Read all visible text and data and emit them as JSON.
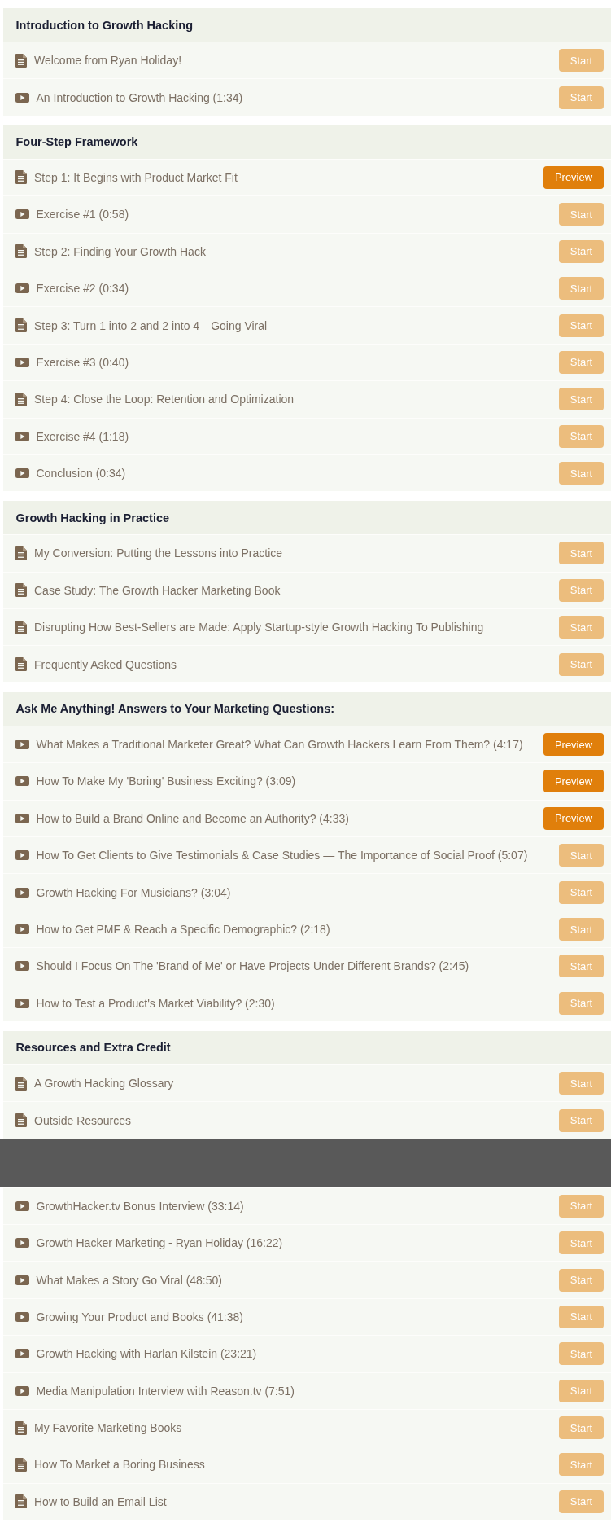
{
  "sections": [
    {
      "title": "Introduction to Growth Hacking",
      "items": [
        {
          "kind": "doc",
          "title": "Welcome from Ryan Holiday!",
          "action": {
            "kind": "start",
            "label": "Start"
          }
        },
        {
          "kind": "video",
          "title": "An Introduction to Growth Hacking (1:34)",
          "action": {
            "kind": "start",
            "label": "Start"
          }
        }
      ]
    },
    {
      "title": "Four-Step Framework",
      "items": [
        {
          "kind": "doc",
          "title": "Step 1: It Begins with Product Market Fit",
          "action": {
            "kind": "preview",
            "label": "Preview"
          }
        },
        {
          "kind": "video",
          "title": "Exercise #1 (0:58)",
          "action": {
            "kind": "start",
            "label": "Start"
          }
        },
        {
          "kind": "doc",
          "title": "Step 2: Finding Your Growth Hack",
          "action": {
            "kind": "start",
            "label": "Start"
          }
        },
        {
          "kind": "video",
          "title": "Exercise #2 (0:34)",
          "action": {
            "kind": "start",
            "label": "Start"
          }
        },
        {
          "kind": "doc",
          "title": "Step 3: Turn 1 into 2 and 2 into 4—Going Viral",
          "action": {
            "kind": "start",
            "label": "Start"
          }
        },
        {
          "kind": "video",
          "title": "Exercise #3 (0:40)",
          "action": {
            "kind": "start",
            "label": "Start"
          }
        },
        {
          "kind": "doc",
          "title": "Step 4: Close the Loop: Retention and Optimization",
          "action": {
            "kind": "start",
            "label": "Start"
          }
        },
        {
          "kind": "video",
          "title": "Exercise #4 (1:18)",
          "action": {
            "kind": "start",
            "label": "Start"
          }
        },
        {
          "kind": "video",
          "title": "Conclusion (0:34)",
          "action": {
            "kind": "start",
            "label": "Start"
          }
        }
      ]
    },
    {
      "title": "Growth Hacking in Practice",
      "items": [
        {
          "kind": "doc",
          "title": "My Conversion: Putting the Lessons into Practice",
          "action": {
            "kind": "start",
            "label": "Start"
          }
        },
        {
          "kind": "doc",
          "title": "Case Study: The Growth Hacker Marketing Book",
          "action": {
            "kind": "start",
            "label": "Start"
          }
        },
        {
          "kind": "doc",
          "title": "Disrupting How Best-Sellers are Made: Apply Startup-style Growth Hacking To Publishing",
          "action": {
            "kind": "start",
            "label": "Start"
          }
        },
        {
          "kind": "doc",
          "title": "Frequently Asked Questions",
          "action": {
            "kind": "start",
            "label": "Start"
          }
        }
      ]
    },
    {
      "title": "Ask Me Anything! Answers to Your Marketing Questions:",
      "items": [
        {
          "kind": "video",
          "title": "What Makes a Traditional Marketer Great? What Can Growth Hackers Learn From Them? (4:17)",
          "action": {
            "kind": "preview",
            "label": "Preview"
          }
        },
        {
          "kind": "video",
          "title": "How To Make My 'Boring' Business Exciting? (3:09)",
          "action": {
            "kind": "preview",
            "label": "Preview"
          }
        },
        {
          "kind": "video",
          "title": "How to Build a Brand Online and Become an Authority? (4:33)",
          "action": {
            "kind": "preview",
            "label": "Preview"
          }
        },
        {
          "kind": "video",
          "title": "How To Get Clients to Give Testimonials & Case Studies — The Importance of Social Proof (5:07)",
          "action": {
            "kind": "start",
            "label": "Start"
          }
        },
        {
          "kind": "video",
          "title": "Growth Hacking For Musicians? (3:04)",
          "action": {
            "kind": "start",
            "label": "Start"
          }
        },
        {
          "kind": "video",
          "title": "How to Get PMF & Reach a Specific Demographic? (2:18)",
          "action": {
            "kind": "start",
            "label": "Start"
          }
        },
        {
          "kind": "video",
          "title": "Should I Focus On The 'Brand of Me' or Have Projects Under Different Brands? (2:45)",
          "action": {
            "kind": "start",
            "label": "Start"
          }
        },
        {
          "kind": "video",
          "title": "How to Test a Product's Market Viability? (2:30)",
          "action": {
            "kind": "start",
            "label": "Start"
          }
        }
      ]
    },
    {
      "title": "Resources and Extra Credit",
      "items": [
        {
          "kind": "doc",
          "title": "A Growth Hacking Glossary",
          "action": {
            "kind": "start",
            "label": "Start"
          }
        },
        {
          "kind": "doc",
          "title": "Outside Resources",
          "action": {
            "kind": "start",
            "label": "Start"
          }
        },
        {
          "kind": "covered"
        },
        {
          "kind": "video",
          "title": "GrowthHacker.tv Bonus Interview (33:14)",
          "action": {
            "kind": "start",
            "label": "Start"
          }
        },
        {
          "kind": "video",
          "title": "Growth Hacker Marketing - Ryan Holiday (16:22)",
          "action": {
            "kind": "start",
            "label": "Start"
          }
        },
        {
          "kind": "video",
          "title": "What Makes a Story Go Viral (48:50)",
          "action": {
            "kind": "start",
            "label": "Start"
          }
        },
        {
          "kind": "video",
          "title": "Growing Your Product and Books (41:38)",
          "action": {
            "kind": "start",
            "label": "Start"
          }
        },
        {
          "kind": "video",
          "title": "Growth Hacking with Harlan Kilstein (23:21)",
          "action": {
            "kind": "start",
            "label": "Start"
          }
        },
        {
          "kind": "video",
          "title": "Media Manipulation Interview with Reason.tv (7:51)",
          "action": {
            "kind": "start",
            "label": "Start"
          }
        },
        {
          "kind": "doc",
          "title": "My Favorite Marketing Books",
          "action": {
            "kind": "start",
            "label": "Start"
          }
        },
        {
          "kind": "doc",
          "title": "How To Market a Boring Business",
          "action": {
            "kind": "start",
            "label": "Start"
          }
        },
        {
          "kind": "doc",
          "title": "How to Build an Email List",
          "action": {
            "kind": "start",
            "label": "Start"
          }
        }
      ]
    }
  ]
}
